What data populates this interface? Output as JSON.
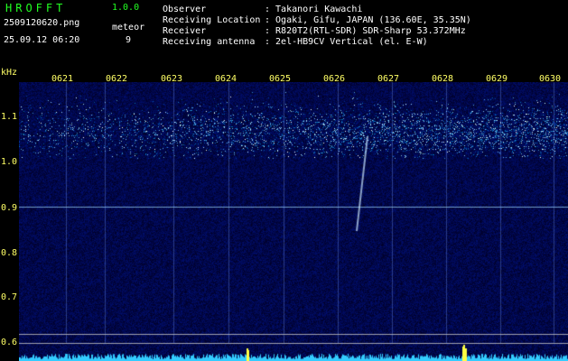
{
  "header": {
    "app_title": "HROFFT",
    "version": "1.0.0",
    "filename": "2509120620.png",
    "timestamp": "25.09.12 06:20",
    "meteor_label": "meteor",
    "meteor_count": "9"
  },
  "info": {
    "rows": [
      {
        "label": "Observer",
        "value": ": Takanori Kawachi"
      },
      {
        "label": "Receiving Location",
        "value": ": Ogaki, Gifu, JAPAN (136.60E, 35.35N)"
      },
      {
        "label": "Receiver",
        "value": ": R820T2(RTL-SDR) SDR-Sharp 53.372MHz"
      },
      {
        "label": "Receiving antenna",
        "value": ": 2el-HB9CV Vertical (el. E-W)"
      }
    ]
  },
  "axes": {
    "freq_unit": "kHz",
    "freq_ticks": [
      "1.1",
      "1.0",
      "0.9",
      "0.8",
      "0.7",
      "0.6"
    ],
    "time_ticks": [
      "0621",
      "0622",
      "0623",
      "0624",
      "0625",
      "0626",
      "0627",
      "0628",
      "0629",
      "0630"
    ]
  },
  "colors": {
    "header_green": "#22ff22",
    "tick_yellow": "#ffff66",
    "background": "#000000",
    "spectrum_cyan": "#33ccff"
  }
}
